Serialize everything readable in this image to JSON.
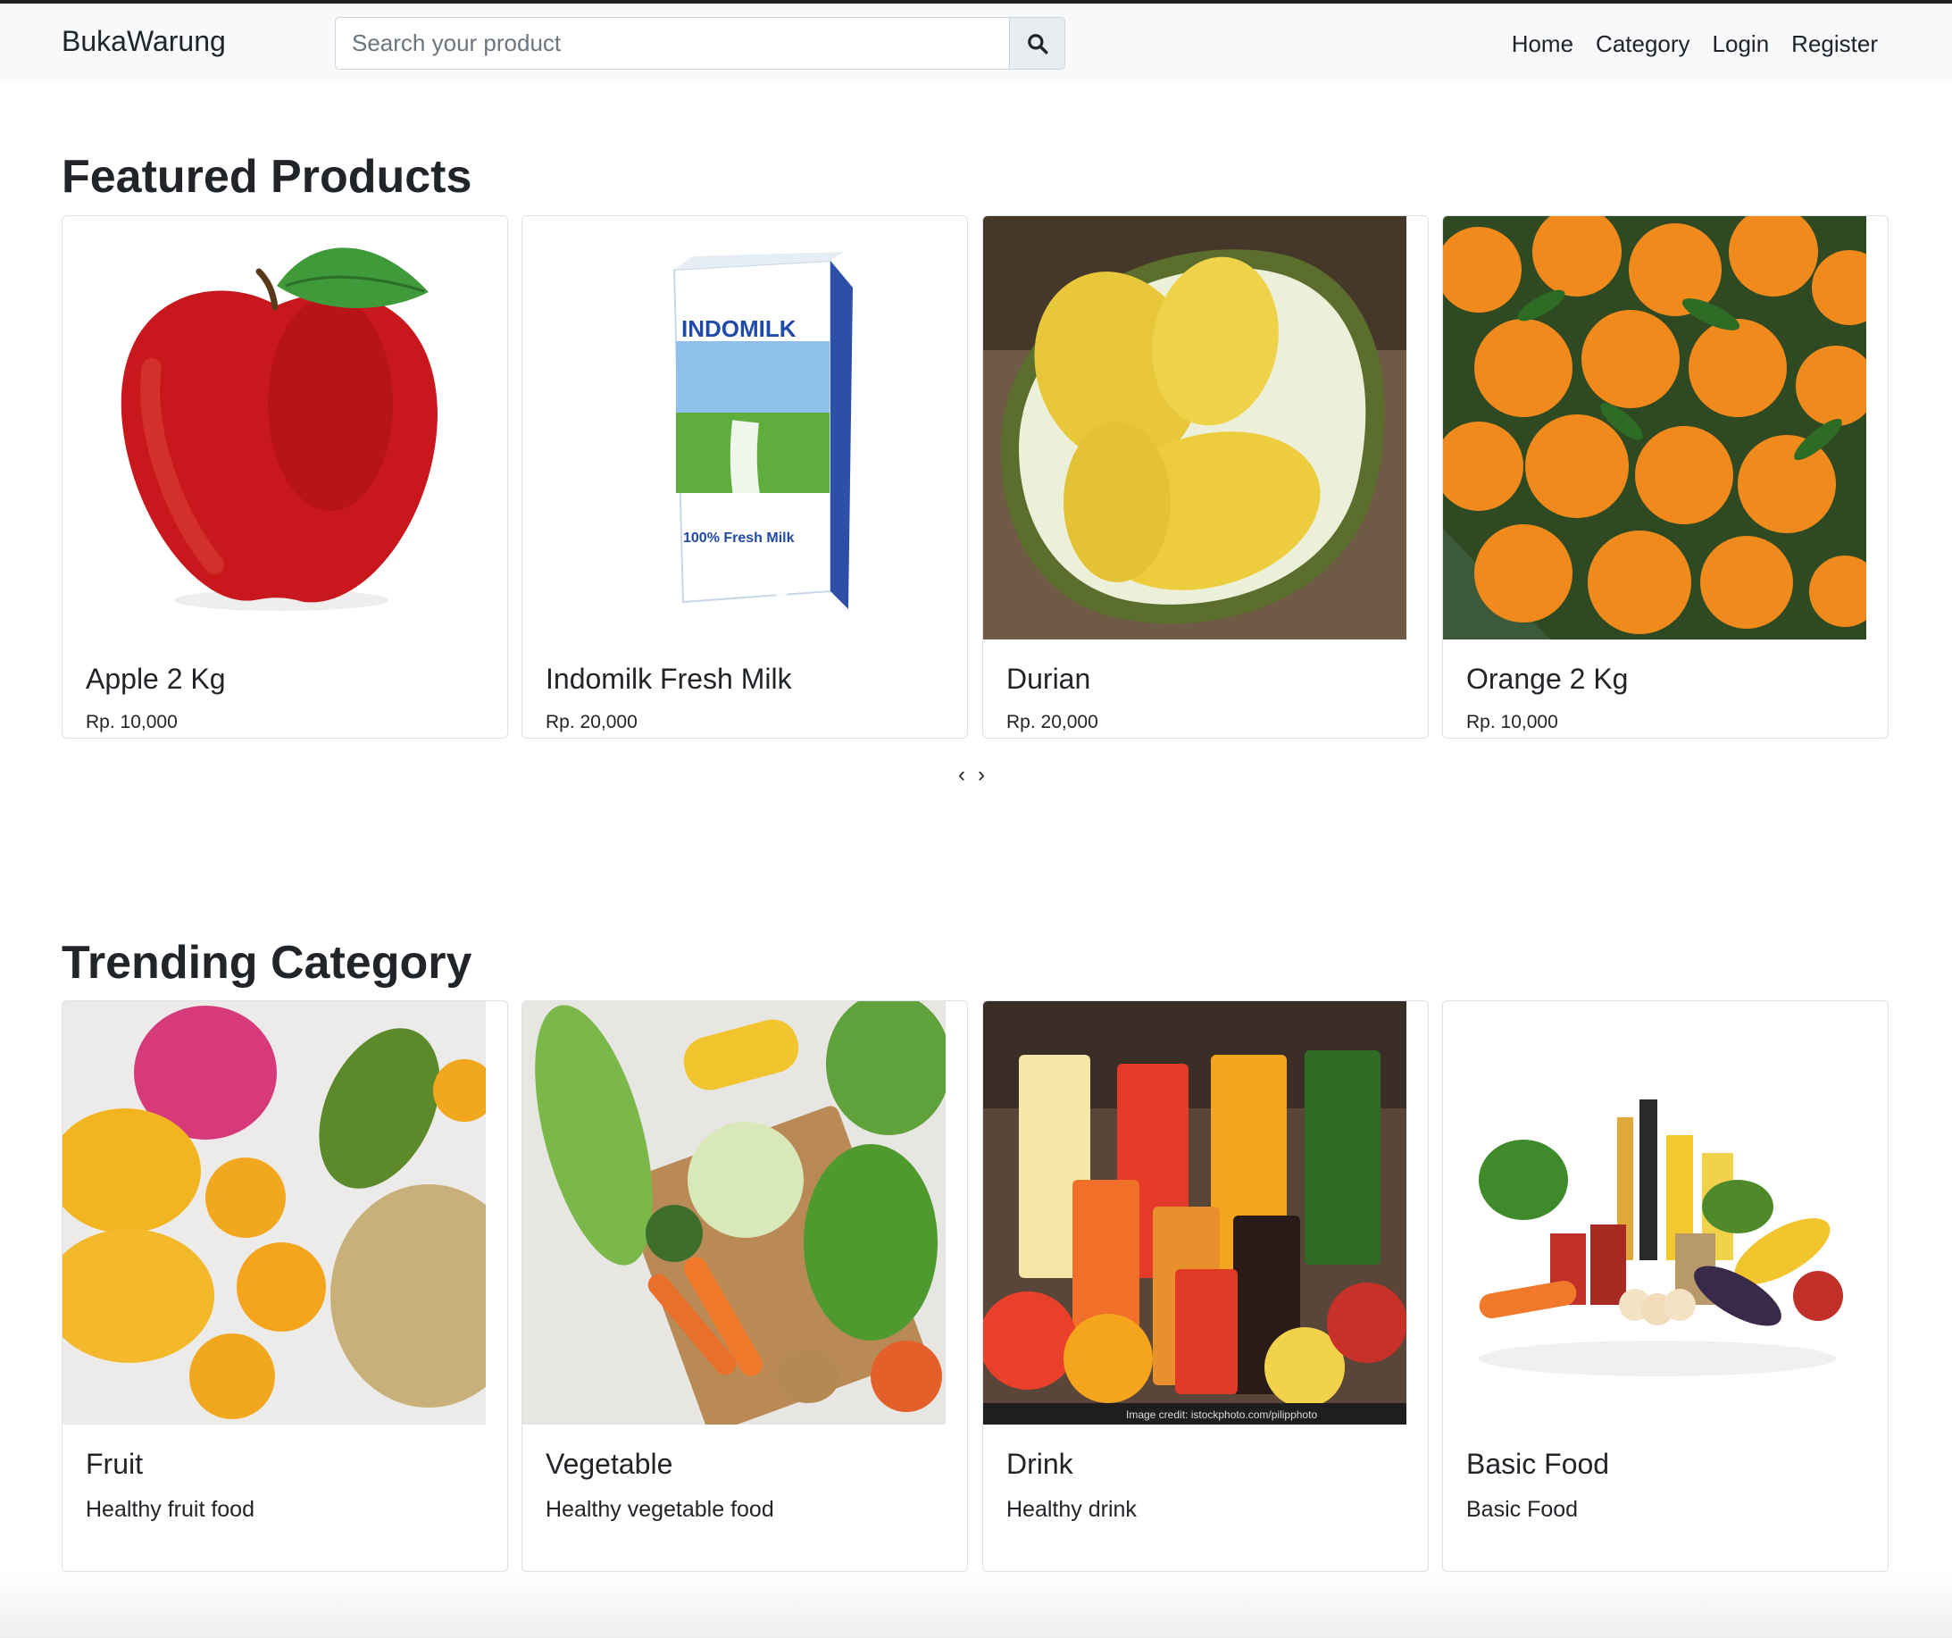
{
  "brand": "BukaWarung",
  "search": {
    "placeholder": "Search your product"
  },
  "nav": {
    "home": "Home",
    "category": "Category",
    "login": "Login",
    "register": "Register"
  },
  "featured": {
    "title": "Featured Products",
    "products": [
      {
        "name": "Apple 2 Kg",
        "price": "Rp. 10,000"
      },
      {
        "name": "Indomilk Fresh Milk",
        "price": "Rp. 20,000"
      },
      {
        "name": "Durian",
        "price": "Rp. 20,000"
      },
      {
        "name": "Orange 2 Kg",
        "price": "Rp. 10,000"
      }
    ],
    "carousel": {
      "prev": "‹",
      "next": "›"
    }
  },
  "trending": {
    "title": "Trending Category",
    "categories": [
      {
        "name": "Fruit",
        "description": "Healthy fruit food"
      },
      {
        "name": "Vegetable",
        "description": "Healthy vegetable food"
      },
      {
        "name": "Drink",
        "description": "Healthy drink"
      },
      {
        "name": "Basic Food",
        "description": "Basic Food"
      }
    ]
  },
  "milk_pack": {
    "brand": "INDOMILK",
    "label": "100% Fresh Milk"
  },
  "image_credit": "Image credit: istockphoto.com/pilipphoto"
}
